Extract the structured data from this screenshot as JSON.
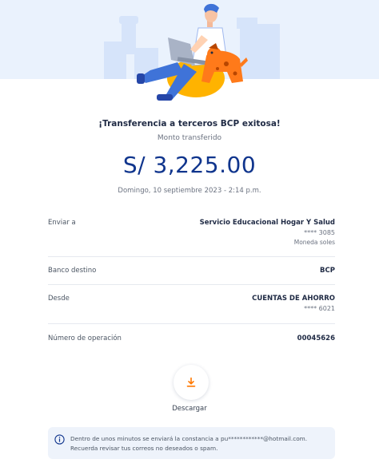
{
  "header": {
    "title": "¡Transferencia a terceros BCP exitosa!",
    "subtitle": "Monto transferido",
    "amount": "S/ 3,225.00",
    "date": "Domingo, 10 septiembre 2023 - 2:14 p.m."
  },
  "details": {
    "send_to": {
      "label": "Enviar a",
      "name": "Servicio Educacional Hogar Y Salud",
      "account": "**** 3085",
      "currency": "Moneda soles"
    },
    "bank": {
      "label": "Banco destino",
      "value": "BCP"
    },
    "from": {
      "label": "Desde",
      "account_type": "CUENTAS DE AHORRO",
      "account": "**** 6021"
    },
    "operation": {
      "label": "Número de operación",
      "value": "00045626"
    }
  },
  "actions": {
    "download_label": "Descargar"
  },
  "notice": {
    "line1": "Dentro de unos minutos se enviará la constancia a pu************@hotmail.com.",
    "line2": "Recuerda revisar tus correos no deseados o spam."
  },
  "colors": {
    "primary": "#10358d",
    "accent": "#ff7800",
    "hero_bg": "#eaf2fd"
  },
  "icons": {
    "download": "download-icon",
    "info": "info-icon"
  }
}
